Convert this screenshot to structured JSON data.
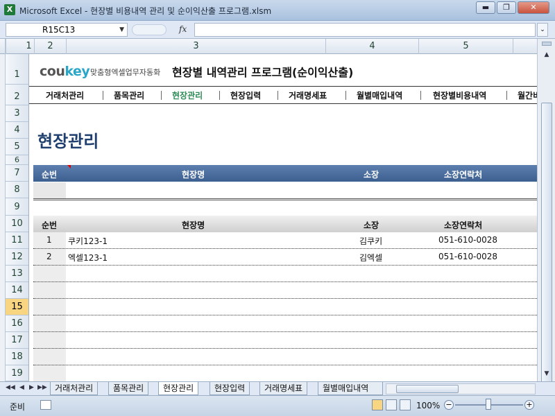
{
  "window": {
    "title": "Microsoft Excel - 현장별 비용내역 관리 및 순이익산출 프로그램.xlsm",
    "app_icon": "X",
    "minimize": "▬",
    "restore": "❐",
    "close": "✕"
  },
  "formula_bar": {
    "name_box": "R15C13",
    "fx_label": "fx",
    "formula": ""
  },
  "columns": [
    "1",
    "2",
    "3",
    "4",
    "5"
  ],
  "rows": [
    "1",
    "2",
    "3",
    "4",
    "5",
    "6",
    "7",
    "8",
    "9",
    "10",
    "11",
    "12",
    "13",
    "14",
    "15",
    "16",
    "17",
    "18",
    "19"
  ],
  "active_row": "15",
  "header": {
    "logo_co": "cou",
    "logo_key": "key",
    "logo_tag": "맞춤형엑셀업무자동화",
    "program_title": "현장별 내역관리 프로그램(순이익산출)"
  },
  "menu": [
    {
      "label": "거래처관리",
      "active": false
    },
    {
      "label": "품목관리",
      "active": false
    },
    {
      "label": "현장관리",
      "active": true
    },
    {
      "label": "현장입력",
      "active": false
    },
    {
      "label": "거래명세표",
      "active": false
    },
    {
      "label": "월별매입내역",
      "active": false
    },
    {
      "label": "현장별비용내역",
      "active": false
    },
    {
      "label": "월간비",
      "active": false
    }
  ],
  "page_heading": "현장관리",
  "input_header": {
    "seq": "순번",
    "site_name": "현장명",
    "manager": "소장",
    "contact": "소장연락처"
  },
  "list_header": {
    "seq": "순번",
    "site_name": "현장명",
    "manager": "소장",
    "contact": "소장연락처"
  },
  "list_rows": [
    {
      "seq": "1",
      "site_name": "쿠키123-1",
      "manager": "김쿠키",
      "contact": "051-610-0028"
    },
    {
      "seq": "2",
      "site_name": "엑셀123-1",
      "manager": "김엑셀",
      "contact": "051-610-0028"
    },
    {
      "seq": "",
      "site_name": "",
      "manager": "",
      "contact": ""
    },
    {
      "seq": "",
      "site_name": "",
      "manager": "",
      "contact": ""
    },
    {
      "seq": "",
      "site_name": "",
      "manager": "",
      "contact": ""
    },
    {
      "seq": "",
      "site_name": "",
      "manager": "",
      "contact": ""
    },
    {
      "seq": "",
      "site_name": "",
      "manager": "",
      "contact": ""
    },
    {
      "seq": "",
      "site_name": "",
      "manager": "",
      "contact": ""
    },
    {
      "seq": "",
      "site_name": "",
      "manager": "",
      "contact": ""
    }
  ],
  "sheet_tabs": [
    {
      "label": "거래처관리",
      "active": false
    },
    {
      "label": "품목관리",
      "active": false
    },
    {
      "label": "현장관리",
      "active": true
    },
    {
      "label": "현장입력",
      "active": false
    },
    {
      "label": "거래명세표",
      "active": false
    },
    {
      "label": "월별매입내역",
      "active": false
    }
  ],
  "tab_nav": [
    "◀◀",
    "◀",
    "▶",
    "▶▶"
  ],
  "status": {
    "ready": "준비",
    "zoom": "100%",
    "zoom_out": "−",
    "zoom_in": "+"
  },
  "colors": {
    "accent_green": "#2e8b57",
    "heading_blue": "#1f3f6e",
    "header_bar_blue": "#4a6fa0",
    "active_row_yellow": "#f8d580"
  }
}
